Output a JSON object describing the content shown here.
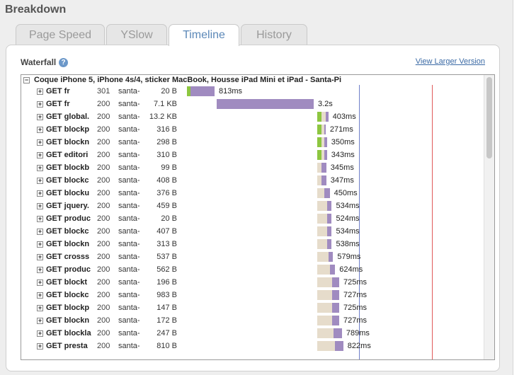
{
  "heading": "Breakdown",
  "tabs": [
    {
      "label": "Page Speed",
      "active": false
    },
    {
      "label": "YSlow",
      "active": false
    },
    {
      "label": "Timeline",
      "active": true
    },
    {
      "label": "History",
      "active": false
    }
  ],
  "waterfall": {
    "title": "Waterfall",
    "help_icon": "question-circle-icon",
    "larger_link": "View Larger Version",
    "page_title": "Coque iPhone 5, iPhone 4s/4, sticker MacBook, Housse iPad Mini et iPad - Santa-Pi",
    "colors": {
      "wait": "#e6dccb",
      "receive": "#a08bc0",
      "dns": "#8dc640",
      "dom_line": "#6f7fc9",
      "load_line": "#e05a5a"
    },
    "requests": [
      {
        "method": "GET fr",
        "status": "301",
        "domain": "santa-",
        "size": "20 B",
        "time": "813ms",
        "start": 0.0,
        "dns": 0.25,
        "wait": 0,
        "receive": 1.78
      },
      {
        "method": "GET fr",
        "status": "200",
        "domain": "santa-",
        "size": "7.1 KB",
        "time": "3.2s",
        "start": 2.2,
        "dns": 0,
        "wait": 0,
        "receive": 7.12
      },
      {
        "method": "GET global.",
        "status": "200",
        "domain": "santa-",
        "size": "13.2 KB",
        "time": "403ms",
        "start": 9.6,
        "dns": 0.3,
        "wait": 0.3,
        "receive": 0.2
      },
      {
        "method": "GET blockp",
        "status": "200",
        "domain": "santa-",
        "size": "316 B",
        "time": "271ms",
        "start": 9.6,
        "dns": 0.3,
        "wait": 0.2,
        "receive": 0.1
      },
      {
        "method": "GET blockn",
        "status": "200",
        "domain": "santa-",
        "size": "298 B",
        "time": "350ms",
        "start": 9.6,
        "dns": 0.3,
        "wait": 0.2,
        "receive": 0.2
      },
      {
        "method": "GET editori",
        "status": "200",
        "domain": "santa-",
        "size": "310 B",
        "time": "343ms",
        "start": 9.6,
        "dns": 0.3,
        "wait": 0.2,
        "receive": 0.2
      },
      {
        "method": "GET blockb",
        "status": "200",
        "domain": "santa-",
        "size": "99 B",
        "time": "345ms",
        "start": 9.6,
        "dns": 0,
        "wait": 0.3,
        "receive": 0.35
      },
      {
        "method": "GET blockc",
        "status": "200",
        "domain": "santa-",
        "size": "408 B",
        "time": "347ms",
        "start": 9.6,
        "dns": 0,
        "wait": 0.3,
        "receive": 0.35
      },
      {
        "method": "GET blocku",
        "status": "200",
        "domain": "santa-",
        "size": "376 B",
        "time": "450ms",
        "start": 9.6,
        "dns": 0,
        "wait": 0.5,
        "receive": 0.4
      },
      {
        "method": "GET jquery.",
        "status": "200",
        "domain": "santa-",
        "size": "459 B",
        "time": "534ms",
        "start": 9.6,
        "dns": 0,
        "wait": 0.7,
        "receive": 0.35
      },
      {
        "method": "GET produc",
        "status": "200",
        "domain": "santa-",
        "size": "20 B",
        "time": "524ms",
        "start": 9.6,
        "dns": 0,
        "wait": 0.7,
        "receive": 0.35
      },
      {
        "method": "GET blockc",
        "status": "200",
        "domain": "santa-",
        "size": "407 B",
        "time": "534ms",
        "start": 9.6,
        "dns": 0,
        "wait": 0.7,
        "receive": 0.35
      },
      {
        "method": "GET blockn",
        "status": "200",
        "domain": "santa-",
        "size": "313 B",
        "time": "538ms",
        "start": 9.6,
        "dns": 0,
        "wait": 0.7,
        "receive": 0.35
      },
      {
        "method": "GET crosss",
        "status": "200",
        "domain": "santa-",
        "size": "537 B",
        "time": "579ms",
        "start": 9.6,
        "dns": 0,
        "wait": 0.8,
        "receive": 0.35
      },
      {
        "method": "GET produc",
        "status": "200",
        "domain": "santa-",
        "size": "562 B",
        "time": "624ms",
        "start": 9.6,
        "dns": 0,
        "wait": 0.9,
        "receive": 0.4
      },
      {
        "method": "GET blockt",
        "status": "200",
        "domain": "santa-",
        "size": "196 B",
        "time": "725ms",
        "start": 9.6,
        "dns": 0,
        "wait": 1.1,
        "receive": 0.5
      },
      {
        "method": "GET blockc",
        "status": "200",
        "domain": "santa-",
        "size": "983 B",
        "time": "727ms",
        "start": 9.6,
        "dns": 0,
        "wait": 1.1,
        "receive": 0.5
      },
      {
        "method": "GET blockp",
        "status": "200",
        "domain": "santa-",
        "size": "147 B",
        "time": "725ms",
        "start": 9.6,
        "dns": 0,
        "wait": 1.1,
        "receive": 0.5
      },
      {
        "method": "GET blockn",
        "status": "200",
        "domain": "santa-",
        "size": "172 B",
        "time": "727ms",
        "start": 9.6,
        "dns": 0,
        "wait": 1.1,
        "receive": 0.5
      },
      {
        "method": "GET blockla",
        "status": "200",
        "domain": "santa-",
        "size": "247 B",
        "time": "789ms",
        "start": 9.6,
        "dns": 0,
        "wait": 1.2,
        "receive": 0.6
      },
      {
        "method": "GET presta",
        "status": "200",
        "domain": "santa-",
        "size": "810 B",
        "time": "822ms",
        "start": 9.6,
        "dns": 0,
        "wait": 1.3,
        "receive": 0.6
      }
    ]
  }
}
